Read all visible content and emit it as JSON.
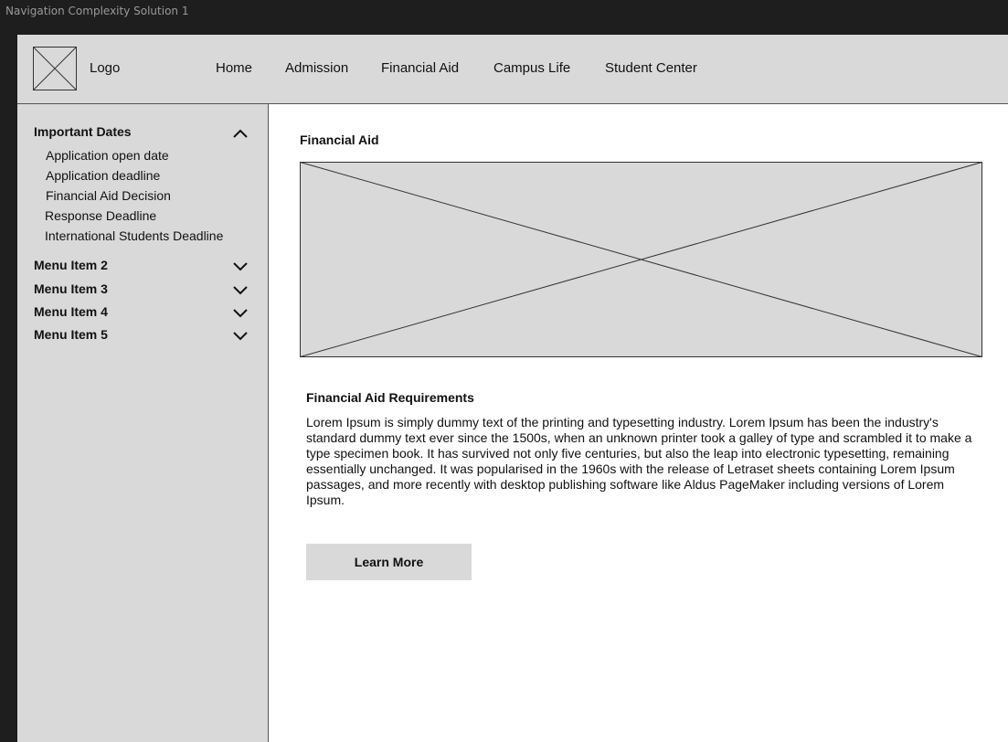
{
  "window": {
    "title": "Navigation Complexity Solution 1"
  },
  "header": {
    "logo_label": "Logo",
    "nav": [
      {
        "label": "Home"
      },
      {
        "label": "Admission"
      },
      {
        "label": "Financial Aid"
      },
      {
        "label": "Campus Life"
      },
      {
        "label": "Student Center"
      }
    ]
  },
  "sidebar": {
    "sections": [
      {
        "title": "Important Dates",
        "expanded": true,
        "items": [
          "Application open date",
          "Application deadline",
          "Financial Aid Decision",
          "Response Deadline",
          "International Students Deadline"
        ]
      },
      {
        "title": "Menu Item 2",
        "expanded": false
      },
      {
        "title": "Menu Item 3",
        "expanded": false
      },
      {
        "title": "Menu Item 4",
        "expanded": false
      },
      {
        "title": "Menu Item 5",
        "expanded": false
      }
    ]
  },
  "main": {
    "title": "Financial Aid",
    "requirements_title": "Financial Aid Requirements",
    "requirements_body": "Lorem Ipsum is simply dummy text of the printing and typesetting industry. Lorem Ipsum has been the industry's standard dummy text ever since the 1500s, when an unknown printer took a galley of type and scrambled it to make a type specimen book. It has survived not only five centuries, but also the leap into electronic typesetting, remaining essentially unchanged. It was popularised in the 1960s with the release of Letraset sheets containing Lorem Ipsum passages, and more recently with desktop publishing software like Aldus PageMaker including versions of Lorem Ipsum.",
    "learn_more_label": "Learn More"
  },
  "colors": {
    "canvas": "#1e1e1e",
    "panel_gray": "#d9d9d9",
    "border": "#555555",
    "text": "#111111"
  }
}
